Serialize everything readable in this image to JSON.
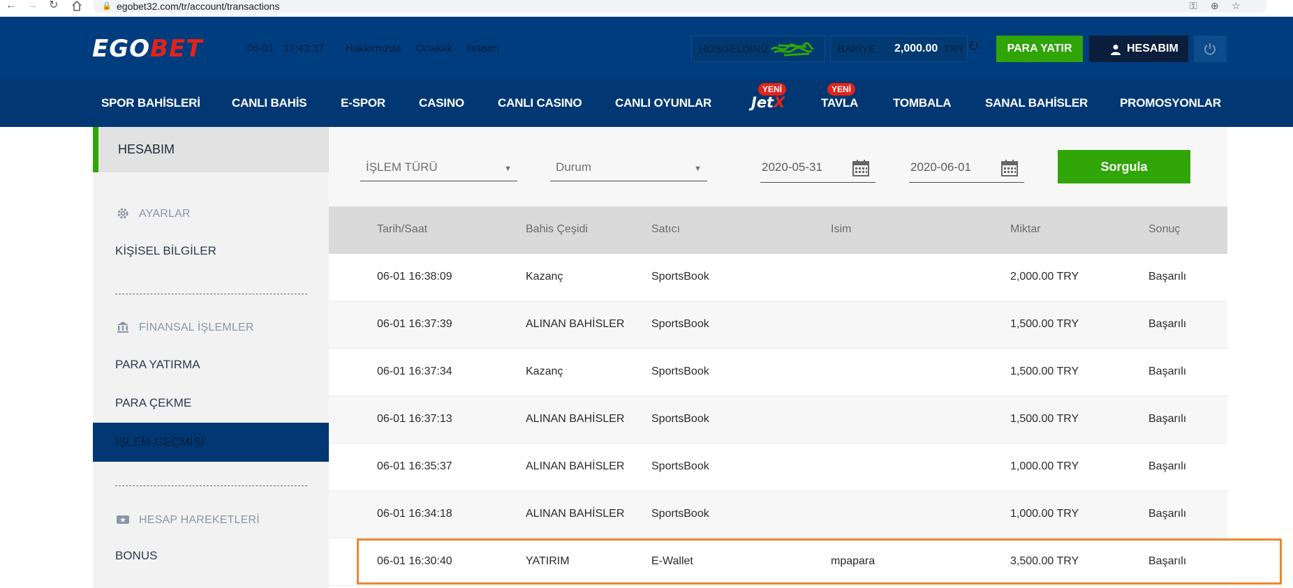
{
  "browser": {
    "url": "egobet32.com/tr/account/transactions",
    "back_icon": "arrow-left-icon",
    "forward_icon": "arrow-right-icon",
    "reload_icon": "reload-icon",
    "home_icon": "home-icon"
  },
  "header": {
    "logo_ego": "EGO",
    "logo_bet": "BET",
    "date": "06-01",
    "time": "17:43:37",
    "links": [
      "Hakkımızda",
      "Ortaklık",
      "İletişim"
    ],
    "welcome_label": "HOŞGELDİNİZ",
    "balance_label": "BAKİYE :",
    "balance_amount": "2,000.00",
    "balance_currency": "TRY",
    "deposit_button": "PARA YATIR",
    "account_button": "HESABIM",
    "colors": {
      "header_bg": "#003d7e",
      "nav_bg": "#013873",
      "accent_green": "#2fa507",
      "accent_red": "#e2231a"
    }
  },
  "nav": {
    "items": [
      "SPOR BAHİSLERİ",
      "CANLI BAHİS",
      "E-SPOR",
      "CASINO",
      "CANLI CASINO",
      "CANLI OYUNLAR",
      "TAVLA",
      "TOMBALA",
      "SANAL BAHİSLER",
      "PROMOSYONLAR"
    ],
    "jetx_jet": "Jet",
    "jetx_x": "X",
    "new_badge": "YENİ"
  },
  "sidebar": {
    "title": "HESABIM",
    "settings_head": "AYARLAR",
    "personal_info": "KİŞİSEL BİLGİLER",
    "finance_head": "FİNANSAL İŞLEMLER",
    "deposit": "PARA YATIRMA",
    "withdraw": "PARA ÇEKME",
    "history": "İŞLEM GEÇMİŞİ",
    "account_head": "HESAP HAREKETLERİ",
    "bonus": "BONUS"
  },
  "filters": {
    "type_label": "İŞLEM TÜRÜ",
    "status_label": "Durum",
    "date_from": "2020-05-31",
    "date_to": "2020-06-01",
    "query_button": "Sorgula"
  },
  "table": {
    "headers": [
      "Tarih/Saat",
      "Bahis Çeşidi",
      "Satıcı",
      "Isim",
      "Miktar",
      "Sonuç"
    ],
    "rows": [
      {
        "datetime": "06-01 16:38:09",
        "type": "Kazanç",
        "vendor": "SportsBook",
        "name": "",
        "amount": "2,000.00 TRY",
        "result": "Başarılı"
      },
      {
        "datetime": "06-01 16:37:39",
        "type": "ALINAN BAHİSLER",
        "vendor": "SportsBook",
        "name": "",
        "amount": "1,500.00 TRY",
        "result": "Başarılı"
      },
      {
        "datetime": "06-01 16:37:34",
        "type": "Kazanç",
        "vendor": "SportsBook",
        "name": "",
        "amount": "1,500.00 TRY",
        "result": "Başarılı"
      },
      {
        "datetime": "06-01 16:37:13",
        "type": "ALINAN BAHİSLER",
        "vendor": "SportsBook",
        "name": "",
        "amount": "1,500.00 TRY",
        "result": "Başarılı"
      },
      {
        "datetime": "06-01 16:35:37",
        "type": "ALINAN BAHİSLER",
        "vendor": "SportsBook",
        "name": "",
        "amount": "1,000.00 TRY",
        "result": "Başarılı"
      },
      {
        "datetime": "06-01 16:34:18",
        "type": "ALINAN BAHİSLER",
        "vendor": "SportsBook",
        "name": "",
        "amount": "1,000.00 TRY",
        "result": "Başarılı"
      },
      {
        "datetime": "06-01 16:30:40",
        "type": "YATIRIM",
        "vendor": "E-Wallet",
        "name": "mpapara",
        "amount": "3,500.00 TRY",
        "result": "Başarılı"
      }
    ]
  }
}
